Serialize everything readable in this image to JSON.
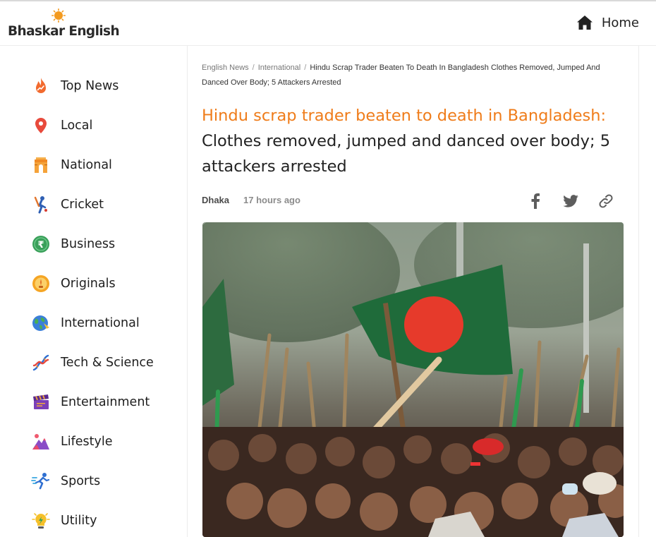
{
  "header": {
    "logo_text": "Bhaskar English",
    "home_label": "Home"
  },
  "sidebar": {
    "items": [
      {
        "label": "Top News",
        "icon": "flame-icon"
      },
      {
        "label": "Local",
        "icon": "map-pin-icon"
      },
      {
        "label": "National",
        "icon": "india-gate-icon"
      },
      {
        "label": "Cricket",
        "icon": "cricket-player-icon"
      },
      {
        "label": "Business",
        "icon": "rupee-coin-icon"
      },
      {
        "label": "Originals",
        "icon": "originals-badge-icon"
      },
      {
        "label": "International",
        "icon": "globe-icon"
      },
      {
        "label": "Tech & Science",
        "icon": "dna-icon"
      },
      {
        "label": "Entertainment",
        "icon": "clapperboard-icon"
      },
      {
        "label": "Lifestyle",
        "icon": "mountain-icon"
      },
      {
        "label": "Sports",
        "icon": "runner-icon"
      },
      {
        "label": "Utility",
        "icon": "lightbulb-icon"
      }
    ]
  },
  "article": {
    "breadcrumb": {
      "items": [
        "English News",
        "International"
      ],
      "current": "Hindu Scrap Trader Beaten To Death In Bangladesh Clothes Removed, Jumped And Danced Over Body; 5 Attackers Arrested"
    },
    "headline_accent": "Hindu scrap trader beaten to death in Bangladesh:",
    "headline_rest": " Clothes removed, jumped and danced over body; 5 attackers arrested",
    "dateline": "Dhaka",
    "time_ago": "17 hours ago",
    "share": [
      "facebook-icon",
      "twitter-icon",
      "link-icon"
    ]
  },
  "colors": {
    "accent": "#ef7c1a",
    "text": "#222222",
    "muted": "#8c8c8c"
  }
}
